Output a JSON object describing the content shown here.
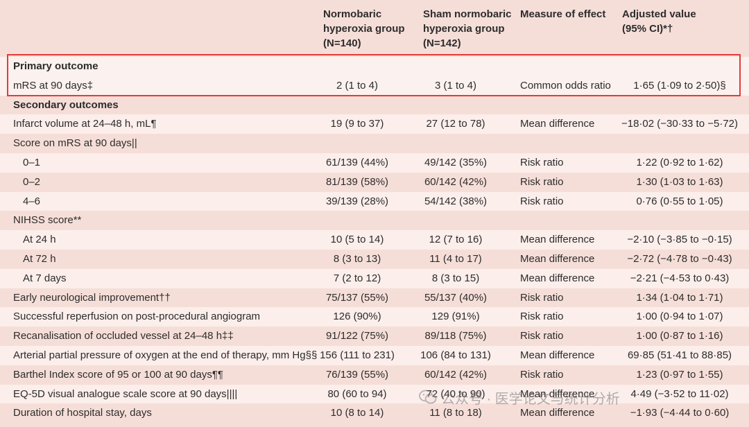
{
  "header": {
    "col1": [
      "Normobaric",
      "hyperoxia group",
      "(N=140)"
    ],
    "col2": [
      "Sham normobaric",
      "hyperoxia group",
      "(N=142)"
    ],
    "col3": [
      "Measure of effect"
    ],
    "col4": [
      "Adjusted value",
      "(95% CI)*†"
    ]
  },
  "rows": [
    {
      "label": "Primary outcome",
      "section": true
    },
    {
      "label": "mRS at 90 days‡",
      "c1": "2 (1 to 4)",
      "c2": "3 (1 to 4)",
      "c3": "Common odds ratio",
      "c4": "1·65 (1·09 to 2·50)§"
    },
    {
      "label": "Secondary outcomes",
      "section": true
    },
    {
      "label": "Infarct volume at 24–48 h, mL¶",
      "c1": "19 (9 to 37)",
      "c2": "27 (12 to 78)",
      "c3": "Mean difference",
      "c4": "−18·02 (−30·33 to −5·72)"
    },
    {
      "label": "Score on mRS at 90 days||"
    },
    {
      "label": "0–1",
      "indent": true,
      "c1": "61/139 (44%)",
      "c2": "49/142 (35%)",
      "c3": "Risk ratio",
      "c4": "1·22 (0·92 to 1·62)"
    },
    {
      "label": "0–2",
      "indent": true,
      "c1": "81/139 (58%)",
      "c2": "60/142 (42%)",
      "c3": "Risk ratio",
      "c4": "1·30 (1·03 to 1·63)"
    },
    {
      "label": "4–6",
      "indent": true,
      "c1": "39/139 (28%)",
      "c2": "54/142 (38%)",
      "c3": "Risk ratio",
      "c4": "0·76 (0·55 to 1·05)"
    },
    {
      "label": "NIHSS score**"
    },
    {
      "label": "At 24 h",
      "indent": true,
      "c1": "10 (5 to 14)",
      "c2": "12 (7 to 16)",
      "c3": "Mean difference",
      "c4": "−2·10 (−3·85 to −0·15)"
    },
    {
      "label": "At 72 h",
      "indent": true,
      "c1": "8 (3 to 13)",
      "c2": "11 (4 to 17)",
      "c3": "Mean difference",
      "c4": "−2·72 (−4·78 to −0·43)"
    },
    {
      "label": "At 7 days",
      "indent": true,
      "c1": "7 (2 to 12)",
      "c2": "8 (3 to 15)",
      "c3": "Mean difference",
      "c4": "−2·21 (−4·53 to 0·43)"
    },
    {
      "label": "Early neurological improvement††",
      "c1": "75/137 (55%)",
      "c2": "55/137 (40%)",
      "c3": "Risk ratio",
      "c4": "1·34 (1·04 to 1·71)"
    },
    {
      "label": "Successful reperfusion on post-procedural angiogram",
      "c1": "126 (90%)",
      "c2": "129 (91%)",
      "c3": "Risk ratio",
      "c4": "1·00 (0·94 to 1·07)"
    },
    {
      "label": "Recanalisation of occluded vessel at 24–48 h‡‡",
      "c1": "91/122 (75%)",
      "c2": "89/118 (75%)",
      "c3": "Risk ratio",
      "c4": "1·00 (0·87 to 1·16)"
    },
    {
      "label": "Arterial partial pressure of oxygen at the end of therapy, mm Hg§§",
      "c1": "156 (111 to 231)",
      "c2": "106 (84 to 131)",
      "c3": "Mean difference",
      "c4": "69·85 (51·41 to 88·85)"
    },
    {
      "label": "Barthel Index score of 95 or 100 at 90 days¶¶",
      "c1": "76/139 (55%)",
      "c2": "60/142 (42%)",
      "c3": "Risk ratio",
      "c4": "1·23 (0·97 to 1·55)"
    },
    {
      "label": "EQ-5D visual analogue scale score at 90 days||||",
      "c1": "80 (60 to 94)",
      "c2": "72 (40 to 90)",
      "c3": "Mean difference",
      "c4": "4·49 (−3·52 to 11·02)"
    },
    {
      "label": "Duration of hospital stay, days",
      "c1": "10 (8 to 14)",
      "c2": "11 (8 to 18)",
      "c3": "Mean difference",
      "c4": "−1·93 (−4·44 to 0·60)"
    }
  ],
  "watermark": {
    "text": "公众号 · 医学论文与统计分析",
    "icon": "wechat-icon"
  }
}
